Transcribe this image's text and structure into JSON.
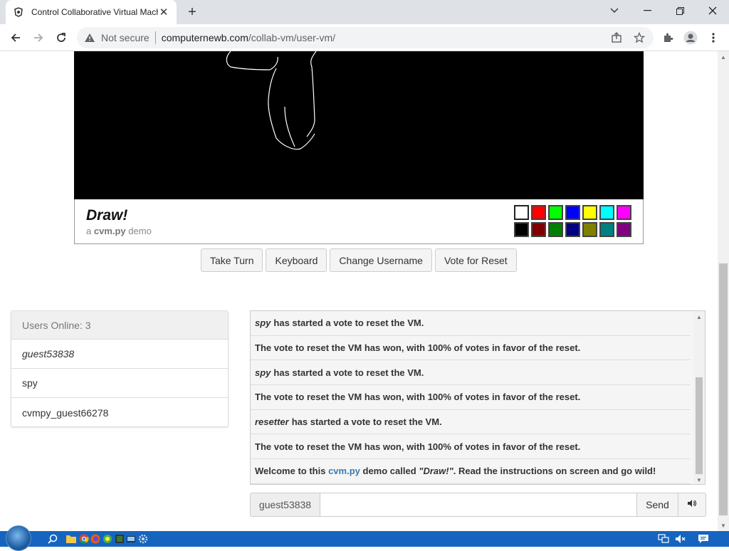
{
  "browser": {
    "tab_title": "Control Collaborative Virtual Machin",
    "address": {
      "security_label": "Not secure",
      "domain": "computernewb.com",
      "path": "/collab-vm/user-vm/"
    }
  },
  "vm": {
    "title": "Draw!",
    "subtitle_prefix": "a",
    "subtitle_brand": "cvm.py",
    "subtitle_suffix": "demo",
    "palette": [
      "#ffffff",
      "#ff0000",
      "#00ff00",
      "#0000ff",
      "#ffff00",
      "#00ffff",
      "#ff00ff",
      "#000000",
      "#800000",
      "#008000",
      "#000080",
      "#808000",
      "#008080",
      "#800080"
    ]
  },
  "controls": {
    "take_turn": "Take Turn",
    "keyboard": "Keyboard",
    "change_username": "Change Username",
    "vote_reset": "Vote for Reset"
  },
  "users": {
    "header": "Users Online: 3",
    "list": [
      "guest53838",
      "spy",
      "cvmpy_guest66278"
    ]
  },
  "chat": {
    "messages": [
      {
        "user": "spy",
        "text": "has started a vote to reset the VM."
      },
      {
        "user": "",
        "text": "The vote to reset the VM has won, with 100% of votes in favor of the reset."
      },
      {
        "user": "spy",
        "text": "has started a vote to reset the VM."
      },
      {
        "user": "",
        "text": "The vote to reset the VM has won, with 100% of votes in favor of the reset."
      },
      {
        "user": "resetter",
        "text": "has started a vote to reset the VM."
      },
      {
        "user": "",
        "text": "The vote to reset the VM has won, with 100% of votes in favor of the reset."
      }
    ],
    "welcome": {
      "pre": "Welcome to this",
      "link": "cvm.py",
      "mid": "demo called",
      "name": "\"Draw!\"",
      "post": ". Read the instructions on screen and go wild!"
    },
    "username": "guest53838",
    "input_value": "",
    "send_label": "Send"
  }
}
